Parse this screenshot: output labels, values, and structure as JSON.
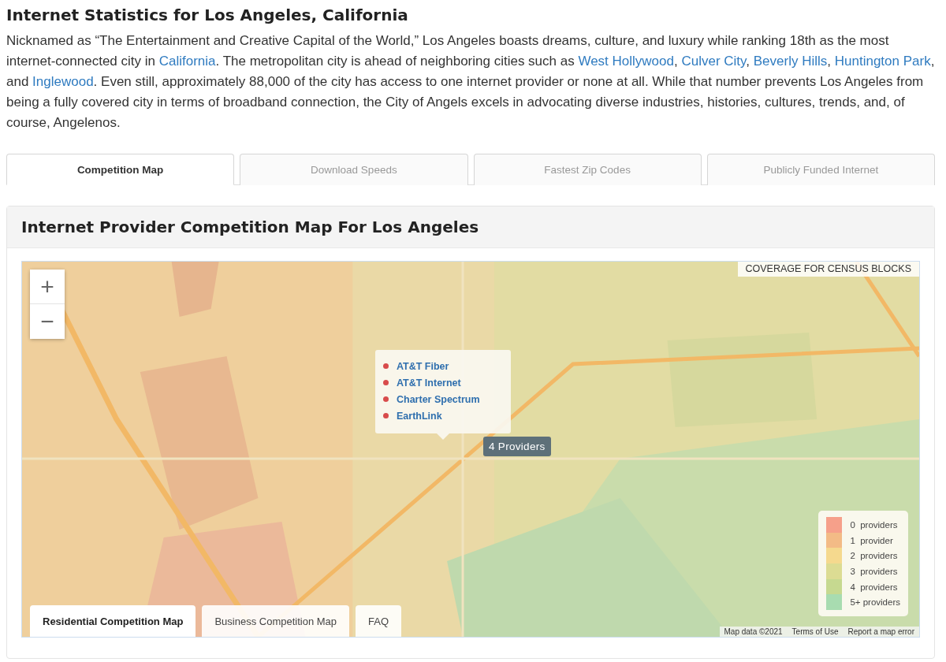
{
  "heading": "Internet Statistics for Los Angeles, California",
  "intro": [
    {
      "text": "Nicknamed as “The Entertainment and Creative Capital of the World,” Los Angeles boasts dreams, culture, and luxury while ranking 18th as the most internet-connected city in ",
      "link": false
    },
    {
      "text": "California",
      "link": true
    },
    {
      "text": ". The metropolitan city is ahead of neighboring cities such as ",
      "link": false
    },
    {
      "text": "West Hollywood",
      "link": true
    },
    {
      "text": ", ",
      "link": false
    },
    {
      "text": "Culver City",
      "link": true
    },
    {
      "text": ", ",
      "link": false
    },
    {
      "text": "Beverly Hills",
      "link": true
    },
    {
      "text": ", ",
      "link": false
    },
    {
      "text": "Huntington Park",
      "link": true
    },
    {
      "text": ", and ",
      "link": false
    },
    {
      "text": "Inglewood",
      "link": true
    },
    {
      "text": ". Even still, approximately 88,000 of the city has access to one internet provider or none at all. While that number prevents Los Angeles from being a fully covered city in terms of broadband connection, the City of Angels excels in advocating diverse industries, histories, cultures, trends, and, of course, Angelenos.",
      "link": false
    }
  ],
  "tabs": [
    {
      "label": "Competition Map",
      "selected": true
    },
    {
      "label": "Download Speeds",
      "selected": false
    },
    {
      "label": "Fastest Zip Codes",
      "selected": false
    },
    {
      "label": "Publicly Funded Internet",
      "selected": false
    }
  ],
  "panel": {
    "title": "Internet Provider Competition Map For Los Angeles",
    "map": {
      "zoom_in": "+",
      "zoom_out": "−",
      "coverage_label": "COVERAGE FOR CENSUS BLOCKS",
      "popup": {
        "providers": [
          "AT&T Fiber",
          "AT&T Internet",
          "Charter Spectrum",
          "EarthLink"
        ]
      },
      "marker_label": "4 Providers",
      "legend": [
        {
          "label": "0  providers",
          "color": "#f6a08a"
        },
        {
          "label": "1  provider",
          "color": "#f3bb86"
        },
        {
          "label": "2  providers",
          "color": "#f5d98e"
        },
        {
          "label": "3  providers",
          "color": "#dcdc93"
        },
        {
          "label": "4  providers",
          "color": "#c6d990"
        },
        {
          "label": "5+ providers",
          "color": "#a8dcb0"
        }
      ],
      "map_tabs": [
        {
          "label": "Residential Competition Map",
          "selected": true
        },
        {
          "label": "Business Competition Map",
          "selected": false
        },
        {
          "label": "FAQ",
          "selected": false
        }
      ],
      "attribution": [
        "Map data ©2021",
        "Terms of Use",
        "Report a map error"
      ]
    }
  }
}
